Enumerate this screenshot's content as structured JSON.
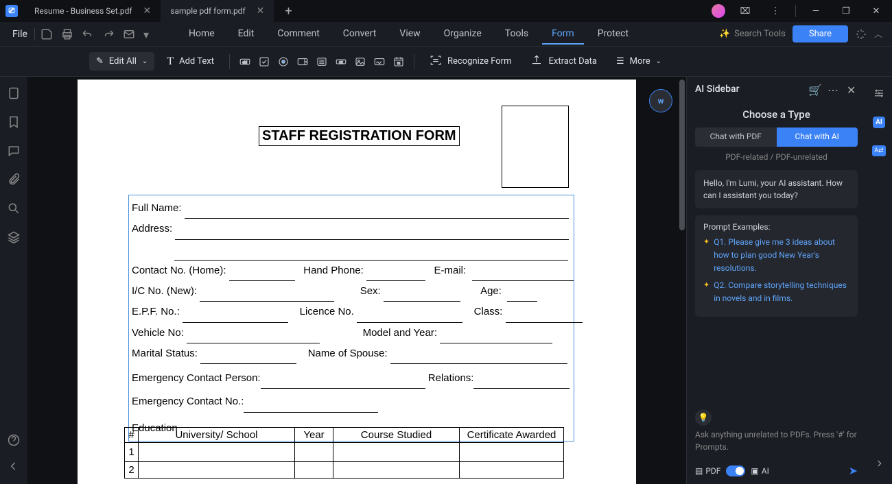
{
  "titlebar": {
    "tabs": [
      {
        "label": "Resume - Business Set.pdf"
      },
      {
        "label": "sample pdf form.pdf"
      }
    ],
    "add": "+"
  },
  "window_controls": {
    "min": "—",
    "max": "❐",
    "close": "✕"
  },
  "menubar": {
    "file": "File",
    "tabs": [
      "Home",
      "Edit",
      "Comment",
      "Convert",
      "View",
      "Organize",
      "Tools",
      "Form",
      "Protect"
    ],
    "active_index": 7,
    "search_placeholder": "Search Tools",
    "share": "Share"
  },
  "toolbar": {
    "edit_all": "Edit All",
    "add_text": "Add Text",
    "recognize_form": "Recognize Form",
    "extract_data": "Extract Data",
    "more": "More"
  },
  "document": {
    "title": "STAFF REGISTRATION FORM",
    "fields": {
      "full_name": "Full Name:",
      "address": "Address:",
      "contact_home": "Contact No. (Home):",
      "hand_phone": "Hand Phone:",
      "email": "E-mail:",
      "ic_no": "I/C No. (New):",
      "sex": "Sex:",
      "age": "Age:",
      "epf": "E.P.F. No.:",
      "licence": "Licence No.",
      "class": "Class:",
      "vehicle": "Vehicle No:",
      "model": "Model and Year:",
      "marital": "Marital Status:",
      "spouse": "Name of Spouse:",
      "emerg_person": "Emergency Contact Person:",
      "relations": "Relations:",
      "emerg_no": "Emergency Contact No.:"
    },
    "education_heading": "Education",
    "education_columns": [
      "#",
      "University/ School",
      "Year",
      "Course Studied",
      "Certificate Awarded"
    ],
    "education_rows": [
      "1",
      "2"
    ]
  },
  "sidebar": {
    "title": "AI Sidebar",
    "choose_type": "Choose a Type",
    "chat_pdf": "Chat with PDF",
    "chat_ai": "Chat with AI",
    "subtype": "PDF-related / PDF-unrelated",
    "greeting": "Hello, I'm Lumi, your AI assistant. How can I assistant you today?",
    "examples_title": "Prompt Examples:",
    "examples": [
      "Q1. Please give me 3 ideas about how to plan good New Year's resolutions.",
      "Q2. Compare storytelling techniques in novels and in films."
    ],
    "input_hint": "Ask anything unrelated to PDFs. Press '#' for Prompts.",
    "mode_pdf": "PDF",
    "mode_ai": "AI"
  }
}
